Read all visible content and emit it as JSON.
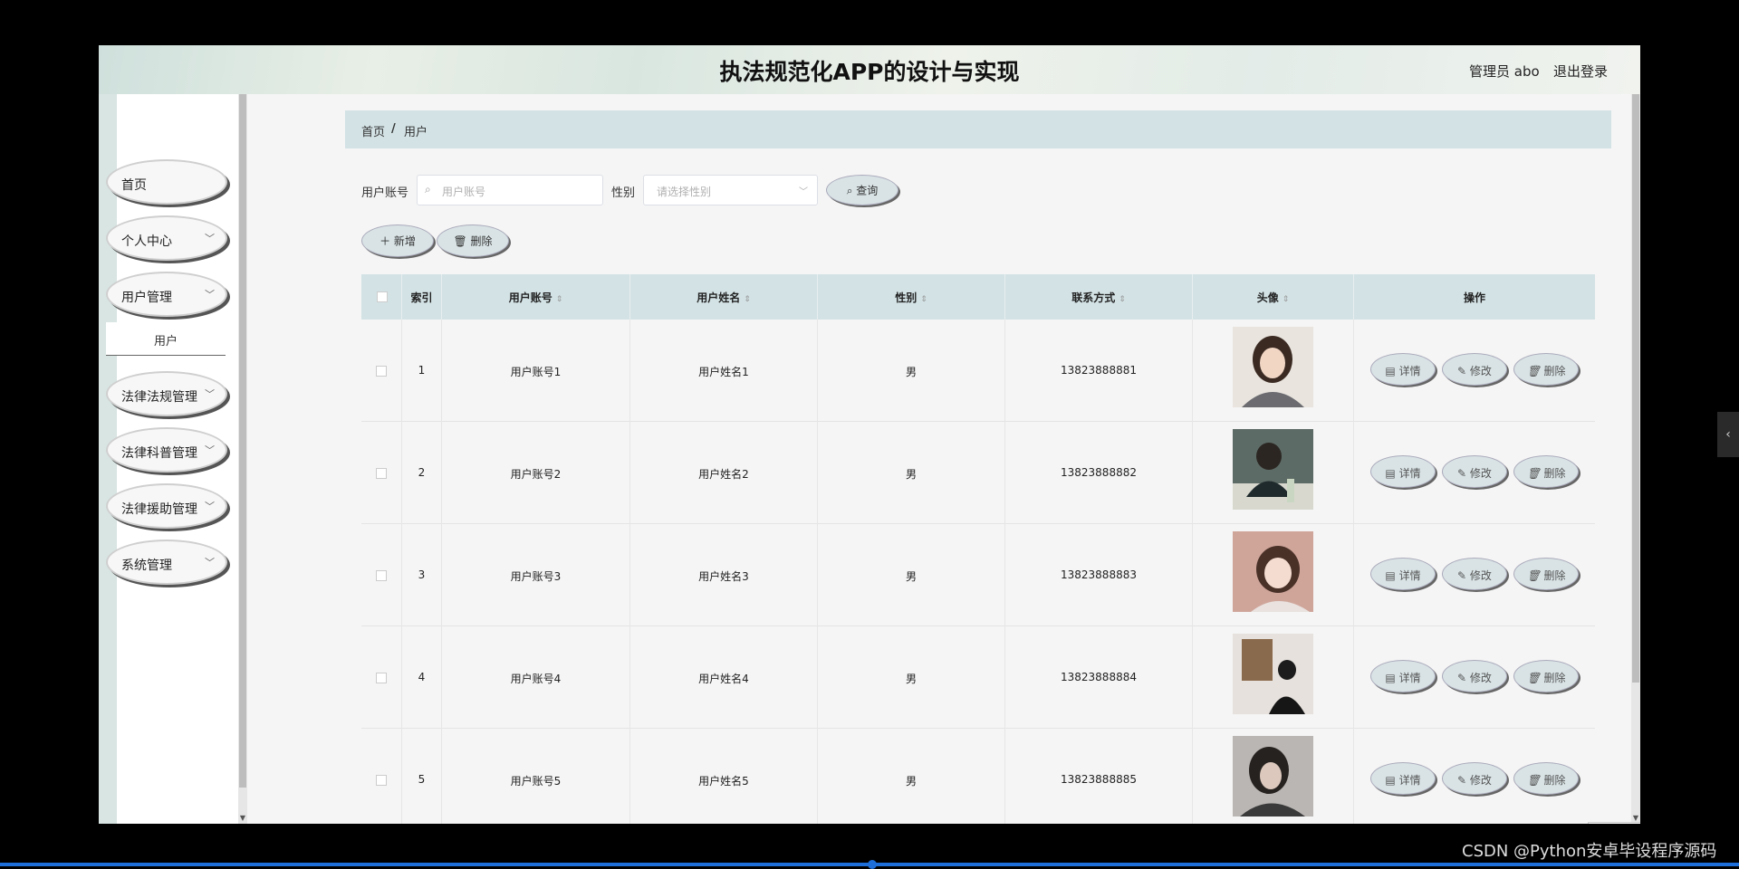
{
  "header": {
    "title": "执法规范化APP的设计与实现",
    "user_label": "管理员 abo",
    "logout": "退出登录"
  },
  "sidebar": {
    "items": [
      {
        "label": "首页",
        "has_chevron": false
      },
      {
        "label": "个人中心",
        "has_chevron": true
      },
      {
        "label": "用户管理",
        "has_chevron": true
      },
      {
        "label": "法律法规管理",
        "has_chevron": true
      },
      {
        "label": "法律科普管理",
        "has_chevron": true
      },
      {
        "label": "法律援助管理",
        "has_chevron": true
      },
      {
        "label": "系统管理",
        "has_chevron": true
      }
    ],
    "submenu": {
      "label": "用户"
    }
  },
  "breadcrumb": {
    "home": "首页",
    "separator": "/",
    "current": "用户"
  },
  "search": {
    "account_label": "用户账号",
    "account_placeholder": "用户账号",
    "gender_label": "性别",
    "gender_placeholder": "请选择性别",
    "query_button": "查询"
  },
  "toolbar": {
    "add_button": "新增",
    "delete_button": "删除"
  },
  "table": {
    "headers": [
      "索引",
      "用户账号",
      "用户姓名",
      "性别",
      "联系方式",
      "头像",
      "操作"
    ],
    "actions": [
      "详情",
      "修改",
      "删除"
    ],
    "rows": [
      {
        "index": "1",
        "account": "用户账号1",
        "name": "用户姓名1",
        "gender": "男",
        "phone": "13823888881"
      },
      {
        "index": "2",
        "account": "用户账号2",
        "name": "用户姓名2",
        "gender": "男",
        "phone": "13823888882"
      },
      {
        "index": "3",
        "account": "用户账号3",
        "name": "用户姓名3",
        "gender": "男",
        "phone": "13823888883"
      },
      {
        "index": "4",
        "account": "用户账号4",
        "name": "用户姓名4",
        "gender": "男",
        "phone": "13823888884"
      },
      {
        "index": "5",
        "account": "用户账号5",
        "name": "用户姓名5",
        "gender": "男",
        "phone": "13823888885"
      }
    ]
  },
  "watermark": "CSDN @Python安卓毕设程序源码",
  "colors": {
    "header_bg": "#d3e2e5",
    "button_bg": "#d9e3e5",
    "progress": "#1e6fd9"
  }
}
